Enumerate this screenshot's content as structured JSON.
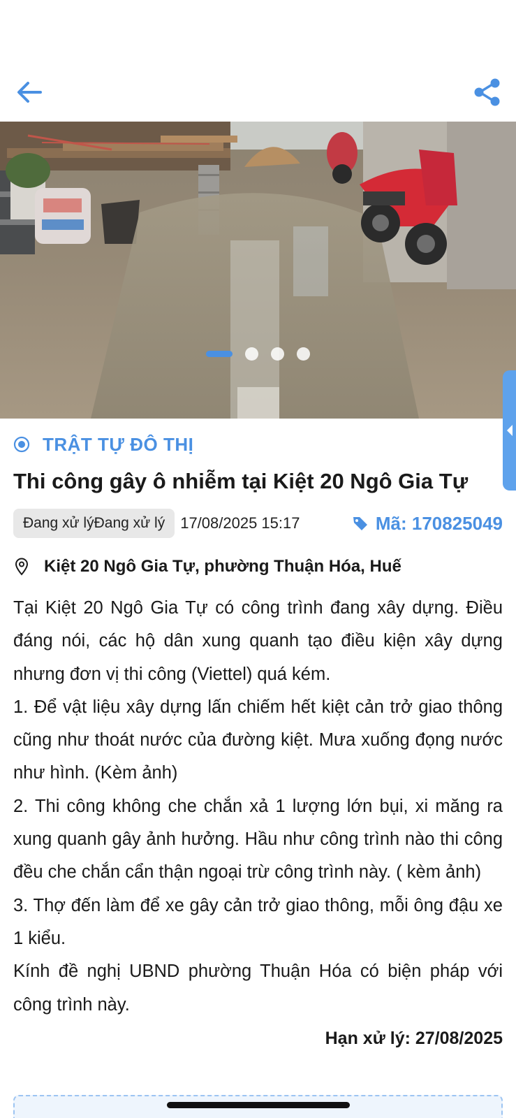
{
  "header": {
    "back_icon": "arrow-left-icon",
    "share_icon": "share-icon",
    "accent_color": "#4a90e2"
  },
  "gallery": {
    "image_count": 4,
    "active_index": 0
  },
  "report": {
    "category": "TRẬT TỰ ĐÔ THỊ",
    "title": "Thi công gây ô nhiễm tại Kiệt 20 Ngô Gia Tự",
    "status": "Đang xử lýĐang xử lý",
    "datetime": "17/08/2025 15:17",
    "code": "Mã: 170825049",
    "address": "Kiệt 20 Ngô Gia Tự, phường Thuận Hóa, Huế",
    "description": [
      "Tại Kiệt 20 Ngô Gia Tự có công trình đang xây dựng. Điều đáng nói, các hộ dân xung quanh tạo điều kiện xây dựng nhưng đơn vị thi công (Viettel) quá kém.",
      "1. Để vật liệu xây dựng lấn chiếm hết kiệt cản trở giao thông cũng như thoát nước của đường kiệt. Mưa xuống đọng nước như hình. (Kèm ảnh)",
      "2. Thi công không che chắn xả 1 lượng lớn bụi, xi măng ra xung quanh gây ảnh hưởng. Hầu như công trình nào thi công đều che chắn cẩn thận ngoại trừ công trình này. ( kèm ảnh)",
      "3. Thợ đến làm để xe gây cản trở giao thông, mỗi ông đậu xe 1 kiểu.",
      "Kính đề nghị UBND phường Thuận Hóa có biện pháp với công trình này."
    ],
    "deadline": "Hạn xử lý: 27/08/2025"
  }
}
